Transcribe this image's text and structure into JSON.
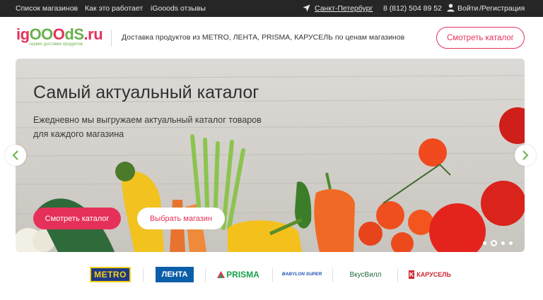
{
  "topbar": {
    "links": [
      "Список магазинов",
      "Как это работает",
      "iGooods отзывы"
    ],
    "city": "Санкт-Петербург",
    "phone": "8 (812) 504 89 52",
    "login": "Войти",
    "register": "/Регистрация"
  },
  "header": {
    "logo_text": "igOOOdS.ru",
    "logo_tagline": "сервис доставки продуктов",
    "tagline": "Доставка продуктов из METRO, ЛЕНТА, PRISMA, КАРУСЕЛЬ по ценам магазинов",
    "catalog_button": "Смотреть каталог"
  },
  "hero": {
    "title": "Самый актуальный каталог",
    "subtitle": "Ежедневно мы выгружаем актуальный каталог товаров для каждого магазина",
    "primary_button": "Смотреть каталог",
    "secondary_button": "Выбрать магазин",
    "prev_icon": "chevron-left-icon",
    "next_icon": "chevron-right-icon",
    "slides_count": 4,
    "active_slide": 2
  },
  "stores": [
    "METRO",
    "ЛЕНТА",
    "PRISMA",
    "BABYLON SUPER",
    "ВкусВилл",
    "КАРУСЕЛЬ"
  ],
  "colors": {
    "accent": "#e5315a",
    "green": "#6ab04c",
    "topbar": "#262626"
  }
}
